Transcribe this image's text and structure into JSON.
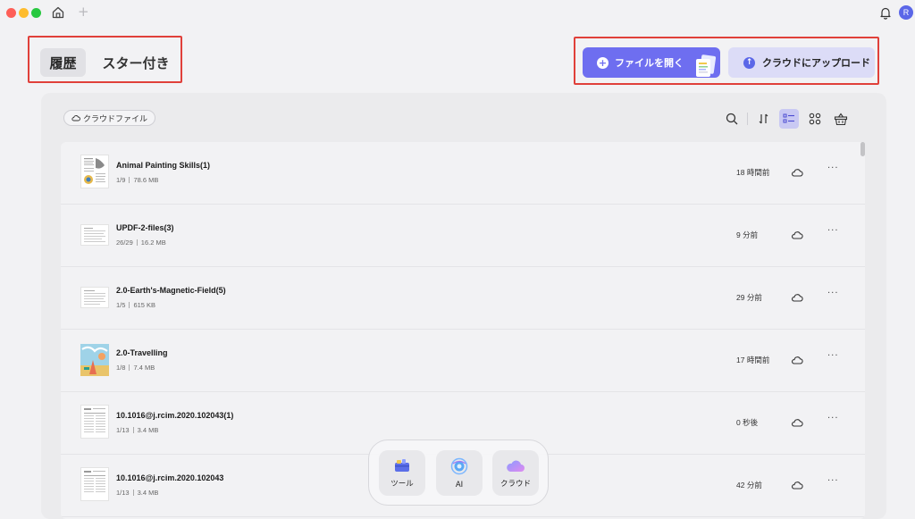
{
  "titlebar": {
    "new_tab": "+",
    "avatar_initial": "R"
  },
  "tabs": [
    {
      "label": "履歴"
    },
    {
      "label": "スター付き"
    }
  ],
  "actions": {
    "open_file": "ファイルを開く",
    "upload_cloud": "クラウドにアップロード"
  },
  "panel": {
    "cloud_filter": "クラウドファイル"
  },
  "files": [
    {
      "name": "Animal Painting Skills(1)",
      "pages": "1/9",
      "size": "78.6 MB",
      "time": "18 時間前"
    },
    {
      "name": "UPDF-2-files(3)",
      "pages": "26/29",
      "size": "16.2 MB",
      "time": "9 分前"
    },
    {
      "name": "2.0-Earth's-Magnetic-Field(5)",
      "pages": "1/5",
      "size": "615 KB",
      "time": "29 分前"
    },
    {
      "name": "2.0-Travelling",
      "pages": "1/8",
      "size": "7.4 MB",
      "time": "17 時間前"
    },
    {
      "name": "10.1016@j.rcim.2020.102043(1)",
      "pages": "1/13",
      "size": "3.4 MB",
      "time": "0 秒後"
    },
    {
      "name": "10.1016@j.rcim.2020.102043",
      "pages": "1/13",
      "size": "3.4 MB",
      "time": "42 分前"
    }
  ],
  "dock": {
    "tools": "ツール",
    "ai": "AI",
    "cloud": "クラウド"
  },
  "colors": {
    "accent": "#6e6ef0",
    "accent_light": "#dcdcf7",
    "highlight_border": "#e0403a"
  }
}
